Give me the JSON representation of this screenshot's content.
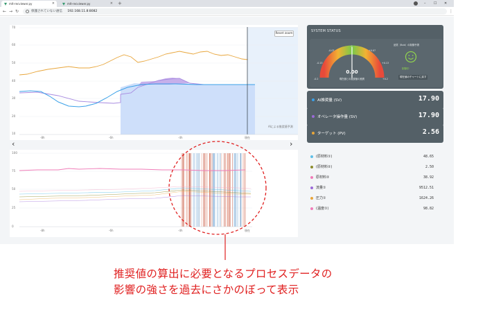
{
  "browser": {
    "tabs": [
      {
        "title": "mlt-recviewer.py",
        "active": true
      },
      {
        "title": "mlt-recviewer.py",
        "active": false
      }
    ],
    "new_tab": "+",
    "security_warning": "保護されていない通信",
    "url": "192.168.11.8:8082",
    "win_minimize": "–",
    "win_maximize": "☐",
    "win_close": "✕"
  },
  "top_chart": {
    "reset_label": "Reset zoom",
    "prediction_label": "AIによる推奨値予測",
    "y_ticks": [
      "70",
      "60",
      "50",
      "40",
      "30",
      "20",
      "10"
    ],
    "x_ticks": [
      "-8h",
      "-6h",
      "-4h",
      "現在"
    ]
  },
  "bottom_chart": {
    "y_ticks": [
      "100",
      "75",
      "50",
      "25",
      "0"
    ],
    "x_ticks": [
      "-8h",
      "-6h",
      "-4h",
      "現在"
    ]
  },
  "nav": {
    "prev": "‹",
    "next": "›"
  },
  "status": {
    "title": "SYSTEM STATUS",
    "gauge": {
      "value": "0.00",
      "caption": "現在値との推奨値の差異",
      "ticks": [
        "-0.07",
        "0",
        "+0.07",
        "-0.13",
        "+0.13",
        "-0.2",
        "+0.2"
      ],
      "needle": 0.0
    },
    "face": {
      "title": "品質（Bob）の制御予測",
      "status": "制御中",
      "link": "現在値のチャートに戻す"
    },
    "values": [
      {
        "label": "AI推奨量 (SV)",
        "value": "17.90",
        "color": "#3aa0e8"
      },
      {
        "label": "オペレータ操作量 (SV)",
        "value": "17.90",
        "color": "#9b6ad8"
      },
      {
        "label": "ターゲット (PV)",
        "value": "2.56",
        "color": "#e8a53a"
      }
    ]
  },
  "legend": [
    {
      "label": "(原材料①)",
      "value": "48.65",
      "color": "#5fc0e8"
    },
    {
      "label": "(原材料②)",
      "value": "2.50",
      "color": "#8c8c2c"
    },
    {
      "label": "原材料②",
      "value": "38.92",
      "color": "#f07cb8"
    },
    {
      "label": "流量①",
      "value": "9512.51",
      "color": "#9b6ad8"
    },
    {
      "label": "圧力①",
      "value": "1624.26",
      "color": "#e8a53a"
    },
    {
      "label": "(温度①)",
      "value": "98.82",
      "color": "#f07cb8"
    }
  ],
  "caption": {
    "line1": "推奨値の算出に必要となるプロセスデータの",
    "line2": "影響の強さを過去にさかのぼって表示"
  },
  "colors": {
    "accent_red": "#e02020",
    "panel": "#546067",
    "line_orange": "#e8a53a",
    "line_blue": "#3aa0e8",
    "line_purple": "#9b6ad8"
  }
}
